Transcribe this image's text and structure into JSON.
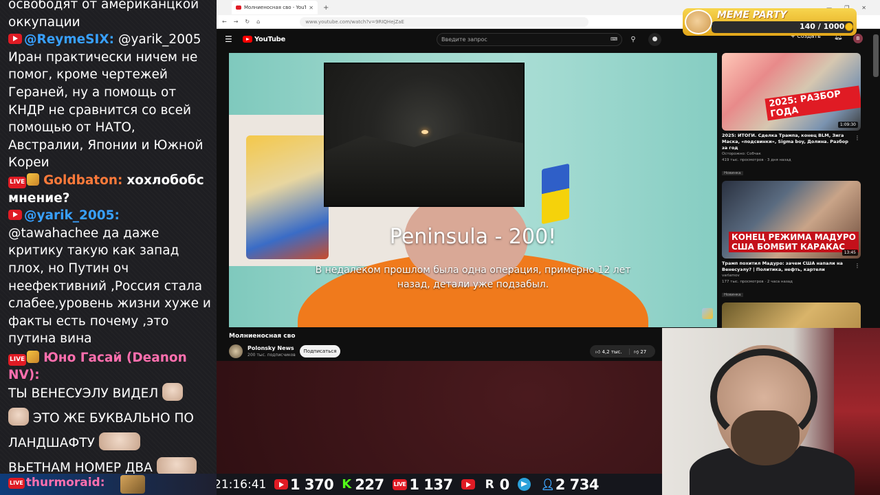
{
  "chat": {
    "messages": [
      {
        "text_lines": "освободят от американцкой оккупации"
      },
      {
        "platform": "youtube",
        "user": "@ReymeSIX:",
        "text": "@yarik_2005 Иран практически ничем не помог, кроме чертежей Гераней, ну а помощь от КНДР не сравнится со всей помощью от НАТО, Австралии, Японии и Южной Кореи"
      },
      {
        "platform": "live",
        "user": "Goldbaton:",
        "text": "хохлобобс мнение?"
      },
      {
        "platform": "youtube",
        "user": "@yarik_2005:",
        "text": "@tawahachee да даже критику такую как запад плох, но Путин оч неефективний ,Россия стала слабее,уровень жизни хуже и факты есть почему ,это путина вина"
      },
      {
        "platform": "live",
        "user": "Юно Гасай (Deanon NV):",
        "line1": "ТЫ ВЕНЕСУЭЛУ ВИДЕЛ",
        "line2": "ЭТО ЖЕ БУКВАЛЬНО ПО",
        "line3": "ЛАНДШАФТУ",
        "line4": "ВЬЕТНАМ НОМЕР ДВА"
      }
    ],
    "bottom_user": "thurmoraid:",
    "live_label": "LIVE"
  },
  "browser": {
    "tab_title": "Молниеносная сво - YouTube",
    "url": "www.youtube.com/watch?v=9RIQHejZaE",
    "search_placeholder": "Введите запрос",
    "create_label": "+ Создать",
    "logo_text": "YouTube",
    "account_initial": "B"
  },
  "video": {
    "title": "Молниеносная сво",
    "subtitle_big": "Peninsula - 200!",
    "subtitle_small_1": "В недалёком прошлом была одна операция, примерно 12 лет",
    "subtitle_small_2": "назад, детали уже подзабыл.",
    "channel": "Polonsky News",
    "channel_subs": "200 тыс. подписчиков",
    "subscribe_label": "Подписаться",
    "likes": "4,2 тыс.",
    "dislikes": "27"
  },
  "related": [
    {
      "title": "2025: ИТОГИ. Сделка Трампа, конец BLM, Зига Маска, «подсвинки», Sigma boy, Долина. Разбор за год",
      "channel": "Осторожно: Собчак",
      "meta": "419 тыс. просмотров · 3 дня назад",
      "badge": "Новинка",
      "duration": "1:09:30",
      "thumb_text": "2025: РАЗБОР ГОДА"
    },
    {
      "title": "Трамп похитил Мадуро: зачем США напали на Венесуэлу? | Политика, нефть, картели",
      "channel": "varlamov",
      "meta": "177 тыс. просмотров · 2 часа назад",
      "badge": "Новинка",
      "duration": "13:45",
      "thumb_text_1": "КОНЕЦ РЕЖИМА МАДУРО",
      "thumb_text_2": "США БОМБИТ КАРАКАС"
    }
  ],
  "meme_party": {
    "title": "MEME PARTY",
    "count": "140 / 1000"
  },
  "stats": {
    "clock": "21:16:41",
    "youtube": "1 370",
    "kick": "227",
    "live": "1 137",
    "play": "",
    "rutube": "0",
    "telegram": "",
    "viewers": "2 734",
    "kick_letter": "K",
    "r_letter": "R"
  },
  "colors": {
    "youtube_red": "#e01b24",
    "kick_green": "#53fc18",
    "chat_user_blue": "#38a0ff",
    "chat_user_pink": "#ff6fae",
    "chat_user_orange": "#ff7a3a"
  }
}
